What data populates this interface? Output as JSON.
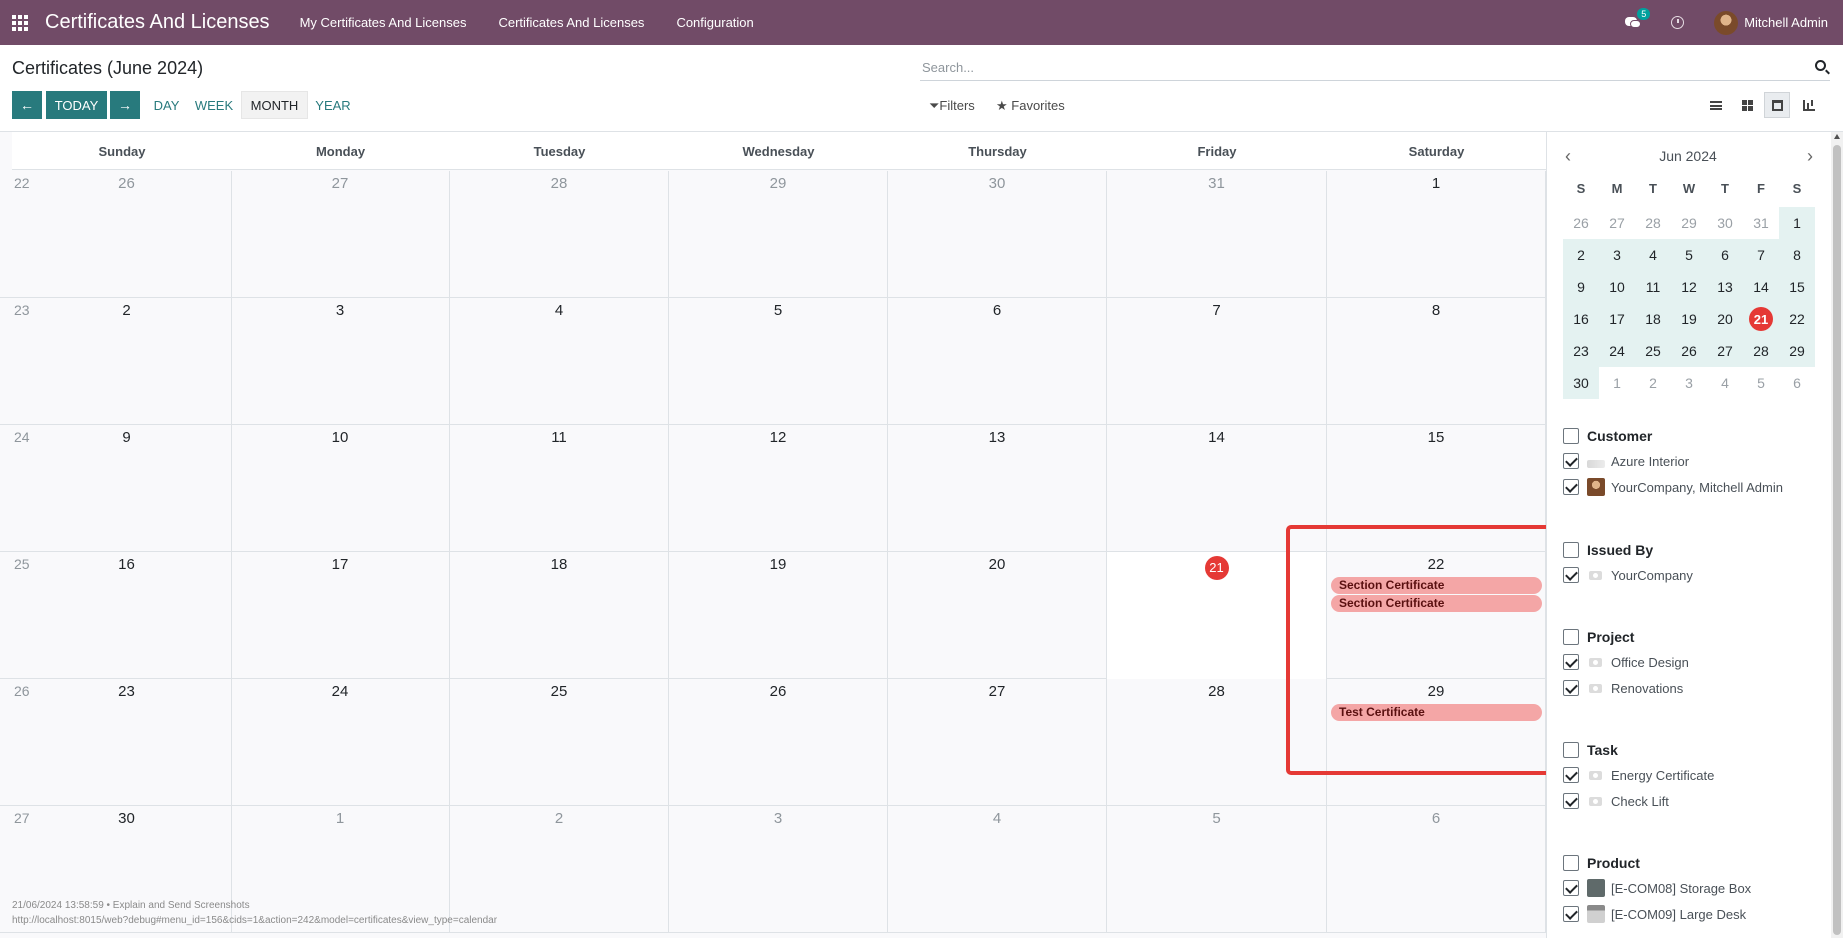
{
  "navbar": {
    "brand": "Certificates And Licenses",
    "menu": [
      "My Certificates And Licenses",
      "Certificates And Licenses",
      "Configuration"
    ],
    "chat_count": "5",
    "user": "Mitchell Admin",
    "bg_color": "#714b67"
  },
  "control": {
    "title": "Certificates (June 2024)",
    "search_placeholder": "Search...",
    "today_label": "TODAY",
    "scales": [
      "DAY",
      "WEEK",
      "MONTH",
      "YEAR"
    ],
    "active_scale": "MONTH",
    "filters_label": "Filters",
    "favorites_label": "Favorites",
    "views": [
      "list-view",
      "kanban-view",
      "calendar-view",
      "graph-view"
    ],
    "active_view": "calendar-view",
    "accent_color": "#287a7d"
  },
  "calendar": {
    "weekdays": [
      "Sunday",
      "Monday",
      "Tuesday",
      "Wednesday",
      "Thursday",
      "Friday",
      "Saturday"
    ],
    "weeks": [
      {
        "num": "22",
        "days": [
          {
            "d": "26",
            "other": true
          },
          {
            "d": "27",
            "other": true
          },
          {
            "d": "28",
            "other": true
          },
          {
            "d": "29",
            "other": true
          },
          {
            "d": "30",
            "other": true
          },
          {
            "d": "31",
            "other": true
          },
          {
            "d": "1"
          }
        ]
      },
      {
        "num": "23",
        "days": [
          {
            "d": "2"
          },
          {
            "d": "3"
          },
          {
            "d": "4"
          },
          {
            "d": "5"
          },
          {
            "d": "6"
          },
          {
            "d": "7"
          },
          {
            "d": "8"
          }
        ]
      },
      {
        "num": "24",
        "days": [
          {
            "d": "9"
          },
          {
            "d": "10"
          },
          {
            "d": "11"
          },
          {
            "d": "12"
          },
          {
            "d": "13"
          },
          {
            "d": "14"
          },
          {
            "d": "15"
          }
        ]
      },
      {
        "num": "25",
        "days": [
          {
            "d": "16"
          },
          {
            "d": "17"
          },
          {
            "d": "18"
          },
          {
            "d": "19"
          },
          {
            "d": "20"
          },
          {
            "d": "21",
            "today": true
          },
          {
            "d": "22",
            "events": [
              "Section Certificate",
              "Section Certificate"
            ]
          }
        ]
      },
      {
        "num": "26",
        "days": [
          {
            "d": "23"
          },
          {
            "d": "24"
          },
          {
            "d": "25"
          },
          {
            "d": "26"
          },
          {
            "d": "27"
          },
          {
            "d": "28"
          },
          {
            "d": "29",
            "events": [
              "Test Certificate"
            ]
          }
        ]
      },
      {
        "num": "27",
        "days": [
          {
            "d": "30"
          },
          {
            "d": "1",
            "other": true
          },
          {
            "d": "2",
            "other": true
          },
          {
            "d": "3",
            "other": true
          },
          {
            "d": "4",
            "other": true
          },
          {
            "d": "5",
            "other": true
          },
          {
            "d": "6",
            "other": true
          }
        ]
      }
    ],
    "today_color": "#e53935",
    "event_color": "#f4a6a6"
  },
  "mini_calendar": {
    "title": "Jun 2024",
    "weekdays": [
      "S",
      "M",
      "T",
      "W",
      "T",
      "F",
      "S"
    ],
    "weeks": [
      [
        {
          "d": "26",
          "other": true
        },
        {
          "d": "27",
          "other": true
        },
        {
          "d": "28",
          "other": true
        },
        {
          "d": "29",
          "other": true
        },
        {
          "d": "30",
          "other": true
        },
        {
          "d": "31",
          "other": true
        },
        {
          "d": "1"
        }
      ],
      [
        {
          "d": "2"
        },
        {
          "d": "3"
        },
        {
          "d": "4"
        },
        {
          "d": "5"
        },
        {
          "d": "6"
        },
        {
          "d": "7"
        },
        {
          "d": "8"
        }
      ],
      [
        {
          "d": "9"
        },
        {
          "d": "10"
        },
        {
          "d": "11"
        },
        {
          "d": "12"
        },
        {
          "d": "13"
        },
        {
          "d": "14"
        },
        {
          "d": "15"
        }
      ],
      [
        {
          "d": "16"
        },
        {
          "d": "17"
        },
        {
          "d": "18"
        },
        {
          "d": "19"
        },
        {
          "d": "20"
        },
        {
          "d": "21",
          "today": true
        },
        {
          "d": "22"
        }
      ],
      [
        {
          "d": "23"
        },
        {
          "d": "24"
        },
        {
          "d": "25"
        },
        {
          "d": "26"
        },
        {
          "d": "27"
        },
        {
          "d": "28"
        },
        {
          "d": "29"
        }
      ],
      [
        {
          "d": "30"
        },
        {
          "d": "1",
          "other": true
        },
        {
          "d": "2",
          "other": true
        },
        {
          "d": "3",
          "other": true
        },
        {
          "d": "4",
          "other": true
        },
        {
          "d": "5",
          "other": true
        },
        {
          "d": "6",
          "other": true
        }
      ]
    ]
  },
  "filters": [
    {
      "title": "Customer",
      "items": [
        {
          "label": "Azure Interior",
          "icon": "azure-logo-icon"
        },
        {
          "label": "YourCompany, Mitchell Admin",
          "icon": "avatar-icon"
        }
      ]
    },
    {
      "title": "Issued By",
      "items": [
        {
          "label": "YourCompany",
          "icon": "camera-icon"
        }
      ]
    },
    {
      "title": "Project",
      "items": [
        {
          "label": "Office Design",
          "icon": "camera-icon"
        },
        {
          "label": "Renovations",
          "icon": "camera-icon"
        }
      ]
    },
    {
      "title": "Task",
      "items": [
        {
          "label": "Energy Certificate",
          "icon": "camera-icon"
        },
        {
          "label": "Check Lift",
          "icon": "camera-icon"
        }
      ]
    },
    {
      "title": "Product",
      "items": [
        {
          "label": "[E-COM08] Storage Box",
          "icon": "storage-box-icon"
        },
        {
          "label": "[E-COM09] Large Desk",
          "icon": "large-desk-icon"
        }
      ]
    }
  ],
  "footer": {
    "line1": "21/06/2024 13:58:59 • Explain and Send Screenshots",
    "line2": "http://localhost:8015/web?debug#menu_id=156&cids=1&action=242&model=certificates&view_type=calendar"
  }
}
